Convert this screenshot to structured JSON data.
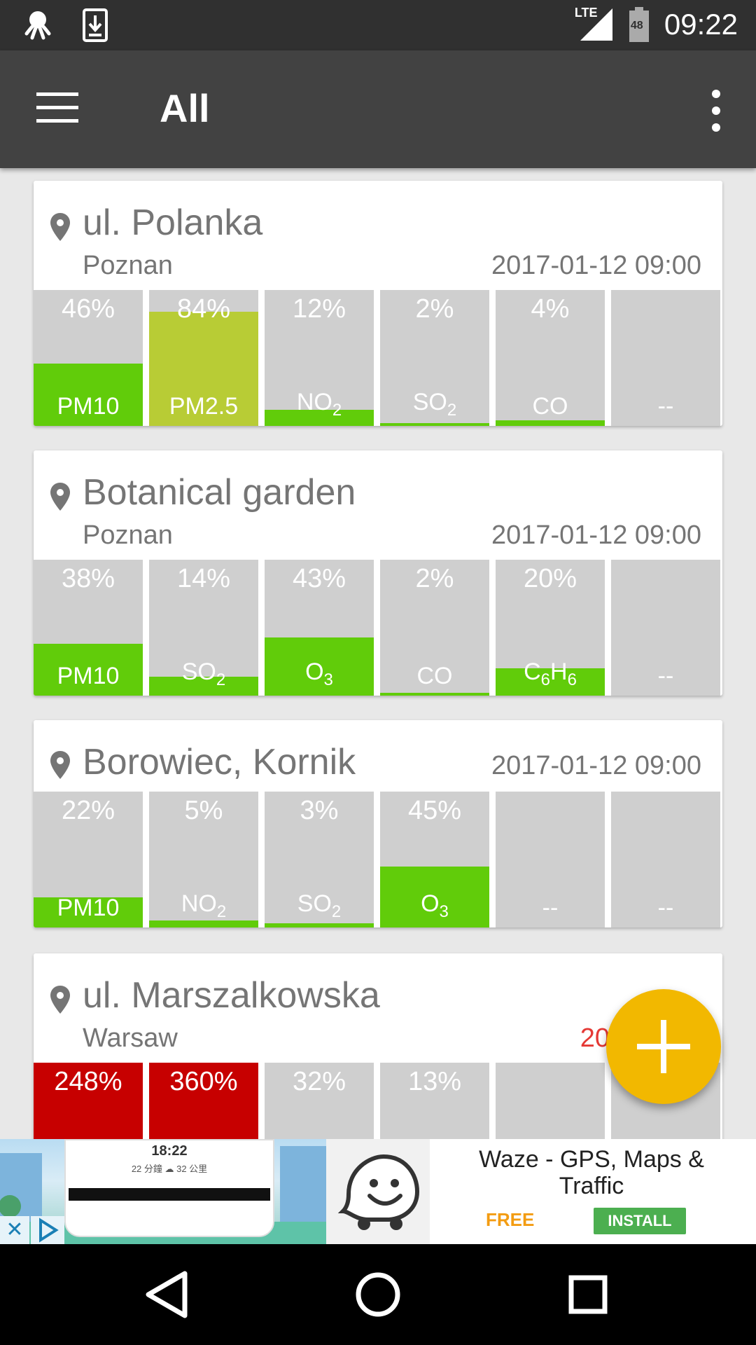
{
  "status_bar": {
    "time": "09:22",
    "network": "LTE",
    "battery": "48"
  },
  "app_bar": {
    "title": "All"
  },
  "colors": {
    "good": "#61cc0a",
    "moderate": "#b8cc35",
    "bad": "#c70000",
    "empty": "#cfcfcf",
    "fab": "#f2b800"
  },
  "stations": [
    {
      "name": "ul. Polanka",
      "city": "Poznan",
      "time": "2017-01-12 09:00",
      "alert": false,
      "bars": [
        {
          "pct": "46%",
          "name": "PM10",
          "sub": "",
          "level": 0.46,
          "color": "good"
        },
        {
          "pct": "84%",
          "name": "PM2.5",
          "sub": "",
          "level": 0.84,
          "color": "moderate"
        },
        {
          "pct": "12%",
          "name": "NO",
          "sub": "2",
          "level": 0.12,
          "color": "good"
        },
        {
          "pct": "2%",
          "name": "SO",
          "sub": "2",
          "level": 0.02,
          "color": "good"
        },
        {
          "pct": "4%",
          "name": "CO",
          "sub": "",
          "level": 0.04,
          "color": "good"
        },
        {
          "pct": "",
          "name": "--",
          "sub": "",
          "level": 0,
          "color": "good"
        }
      ]
    },
    {
      "name": "Botanical garden",
      "city": "Poznan",
      "time": "2017-01-12 09:00",
      "alert": false,
      "bars": [
        {
          "pct": "38%",
          "name": "PM10",
          "sub": "",
          "level": 0.38,
          "color": "good"
        },
        {
          "pct": "14%",
          "name": "SO",
          "sub": "2",
          "level": 0.14,
          "color": "good"
        },
        {
          "pct": "43%",
          "name": "O",
          "sub": "3",
          "level": 0.43,
          "color": "good"
        },
        {
          "pct": "2%",
          "name": "CO",
          "sub": "",
          "level": 0.02,
          "color": "good"
        },
        {
          "pct": "20%",
          "name": "C<sub>6</sub>H<sub>6</sub>",
          "sub": "",
          "level": 0.2,
          "color": "good",
          "html": true
        },
        {
          "pct": "",
          "name": "--",
          "sub": "",
          "level": 0,
          "color": "good"
        }
      ]
    },
    {
      "name": "Borowiec, Kornik",
      "city": "",
      "time": "2017-01-12 09:00",
      "alert": false,
      "bars": [
        {
          "pct": "22%",
          "name": "PM10",
          "sub": "",
          "level": 0.22,
          "color": "good"
        },
        {
          "pct": "5%",
          "name": "NO",
          "sub": "2",
          "level": 0.05,
          "color": "good"
        },
        {
          "pct": "3%",
          "name": "SO",
          "sub": "2",
          "level": 0.03,
          "color": "good"
        },
        {
          "pct": "45%",
          "name": "O",
          "sub": "3",
          "level": 0.45,
          "color": "good"
        },
        {
          "pct": "",
          "name": "--",
          "sub": "",
          "level": 0,
          "color": "good"
        },
        {
          "pct": "",
          "name": "--",
          "sub": "",
          "level": 0,
          "color": "good"
        }
      ]
    },
    {
      "name": "ul. Marszalkowska",
      "city": "Warsaw",
      "time": "2017-01-1",
      "alert": true,
      "bars": [
        {
          "pct": "248%",
          "name": "",
          "sub": "",
          "level": 1.0,
          "color": "bad"
        },
        {
          "pct": "360%",
          "name": "",
          "sub": "",
          "level": 1.0,
          "color": "bad"
        },
        {
          "pct": "32%",
          "name": "",
          "sub": "",
          "level": 0,
          "color": "good"
        },
        {
          "pct": "13%",
          "name": "",
          "sub": "",
          "level": 0,
          "color": "good"
        },
        {
          "pct": "",
          "name": "",
          "sub": "",
          "level": 0,
          "color": "good"
        },
        {
          "pct": "",
          "name": "",
          "sub": "",
          "level": 0,
          "color": "good"
        }
      ]
    }
  ],
  "ad": {
    "phone_time": "18:22",
    "phone_sub": "22 分鐘  ☁  32 公里",
    "title": "Waze - GPS, Maps & Traffic",
    "price": "FREE",
    "install_label": "INSTALL",
    "close_glyph": "✕"
  }
}
